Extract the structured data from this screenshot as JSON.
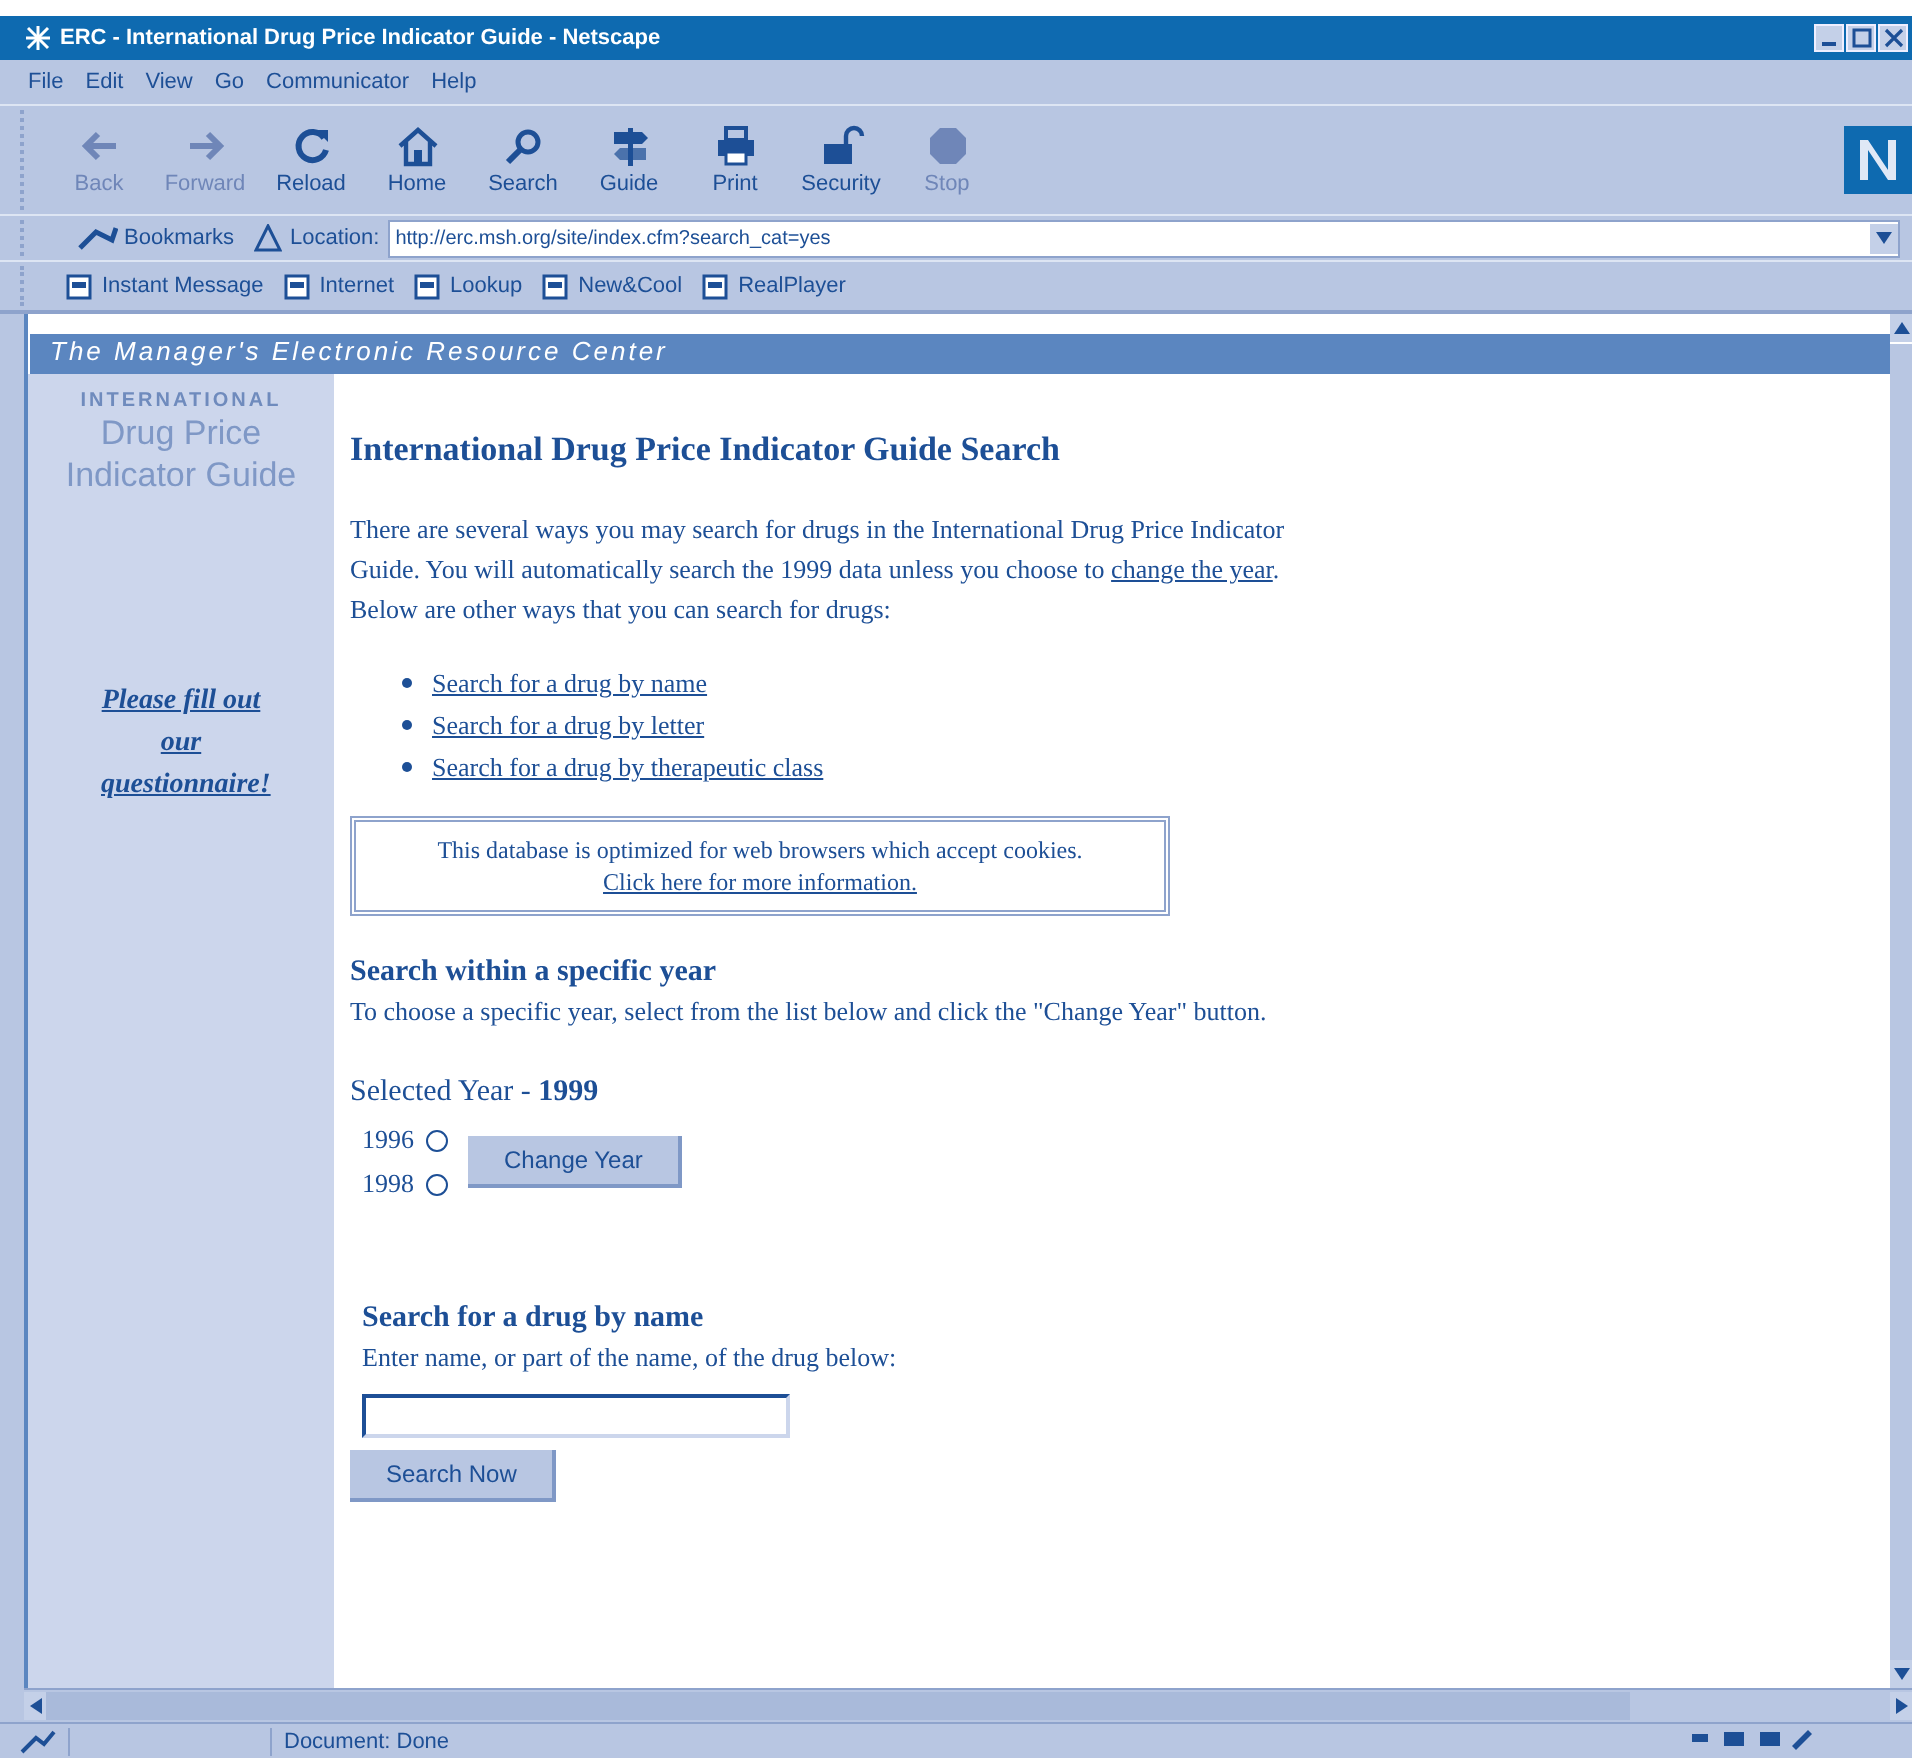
{
  "window": {
    "title": "ERC - International Drug Price Indicator Guide - Netscape"
  },
  "menu": [
    "File",
    "Edit",
    "View",
    "Go",
    "Communicator",
    "Help"
  ],
  "toolbar": [
    {
      "label": "Back",
      "kind": "back",
      "disabled": true
    },
    {
      "label": "Forward",
      "kind": "forward",
      "disabled": true
    },
    {
      "label": "Reload",
      "kind": "reload",
      "disabled": false
    },
    {
      "label": "Home",
      "kind": "home",
      "disabled": false
    },
    {
      "label": "Search",
      "kind": "search",
      "disabled": false
    },
    {
      "label": "Guide",
      "kind": "guide",
      "disabled": false
    },
    {
      "label": "Print",
      "kind": "print",
      "disabled": false
    },
    {
      "label": "Security",
      "kind": "security",
      "disabled": false
    },
    {
      "label": "Stop",
      "kind": "stop",
      "disabled": true
    }
  ],
  "location_bar": {
    "bookmarks": "Bookmarks",
    "label": "Location:",
    "url": "http://erc.msh.org/site/index.cfm?search_cat=yes"
  },
  "personal_toolbar": [
    "Instant Message",
    "Internet",
    "Lookup",
    "New&Cool",
    "RealPlayer"
  ],
  "page": {
    "banner": "The Manager's Electronic Resource Center",
    "sidebar": {
      "logo_top": "INTERNATIONAL",
      "logo_line1": "Drug Price",
      "logo_line2": "Indicator Guide",
      "link": "Please fill out our questionnaire!"
    },
    "heading": "International Drug Price Indicator Guide Search",
    "intro_before": "There are several ways you may search for drugs in the International Drug Price Indicator Guide. You will automatically search the 1999 data unless you choose to",
    "intro_link": "change the year",
    "intro_after": ". Below are other ways that you can search for drugs:",
    "links": [
      "Search for a drug by name",
      "Search for a drug by letter",
      "Search for a drug by therapeutic class"
    ],
    "notice": {
      "text": "This database is optimized for web browsers which accept cookies.",
      "link": "Click here for more information."
    },
    "year_section": {
      "heading": "Search within a specific year",
      "text": "To choose a specific year, select from the list below and click the \"Change Year\" button.",
      "selected_label": "Selected Year - ",
      "selected_value": "1999",
      "options": [
        {
          "label": "1996",
          "selected": false
        },
        {
          "label": "1998",
          "selected": false
        }
      ],
      "button": "Change Year"
    },
    "name_section": {
      "heading": "Search for a drug by name",
      "text": "Enter name, or part of the name, of the drug below:",
      "button": "Search Now"
    }
  },
  "status_bar": {
    "text": "Document: Done"
  }
}
